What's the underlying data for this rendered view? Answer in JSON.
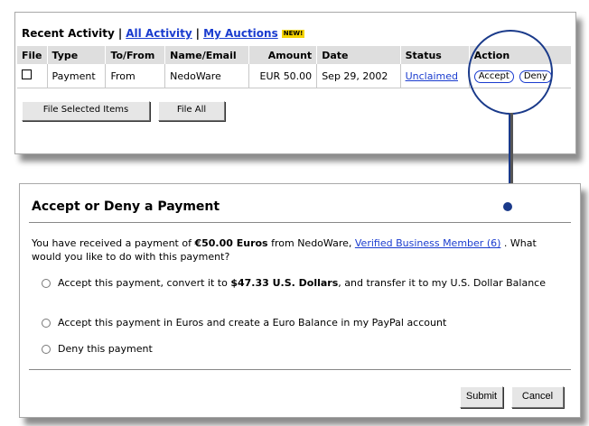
{
  "activity": {
    "title": "Recent Activity",
    "link_all": "All Activity",
    "link_auctions": "My Auctions",
    "new_badge": "NEW!",
    "columns": [
      "File",
      "Type",
      "To/From",
      "Name/Email",
      "Amount",
      "Date",
      "Status",
      "Action"
    ],
    "row": {
      "type": "Payment",
      "to_from": "From",
      "name": "NedoWare",
      "amount": "EUR 50.00",
      "date": "Sep 29, 2002",
      "status": "Unclaimed",
      "accept": "Accept",
      "deny": "Deny"
    },
    "btn_file_selected": "File Selected Items",
    "btn_file_all": "File All"
  },
  "payment": {
    "title": "Accept or Deny a Payment",
    "intro_a": "You have received a payment of ",
    "intro_amount": "€50.00 Euros",
    "intro_b": " from NedoWare, ",
    "verified_link": "Verified Business Member (6)",
    "intro_c": " . What would you like to do with this payment?",
    "option1_a": "Accept this payment, convert it to ",
    "option1_amount": "$47.33 U.S. Dollars",
    "option1_b": ", and transfer it to my U.S. Dollar Balance",
    "option2": "Accept this payment in Euros and create a Euro Balance in my PayPal account",
    "option3": "Deny this payment",
    "submit": "Submit",
    "cancel": "Cancel"
  },
  "colors": {
    "link": "#1a3ccf",
    "header_bg": "#dedede",
    "accent": "#1a3a8a"
  }
}
